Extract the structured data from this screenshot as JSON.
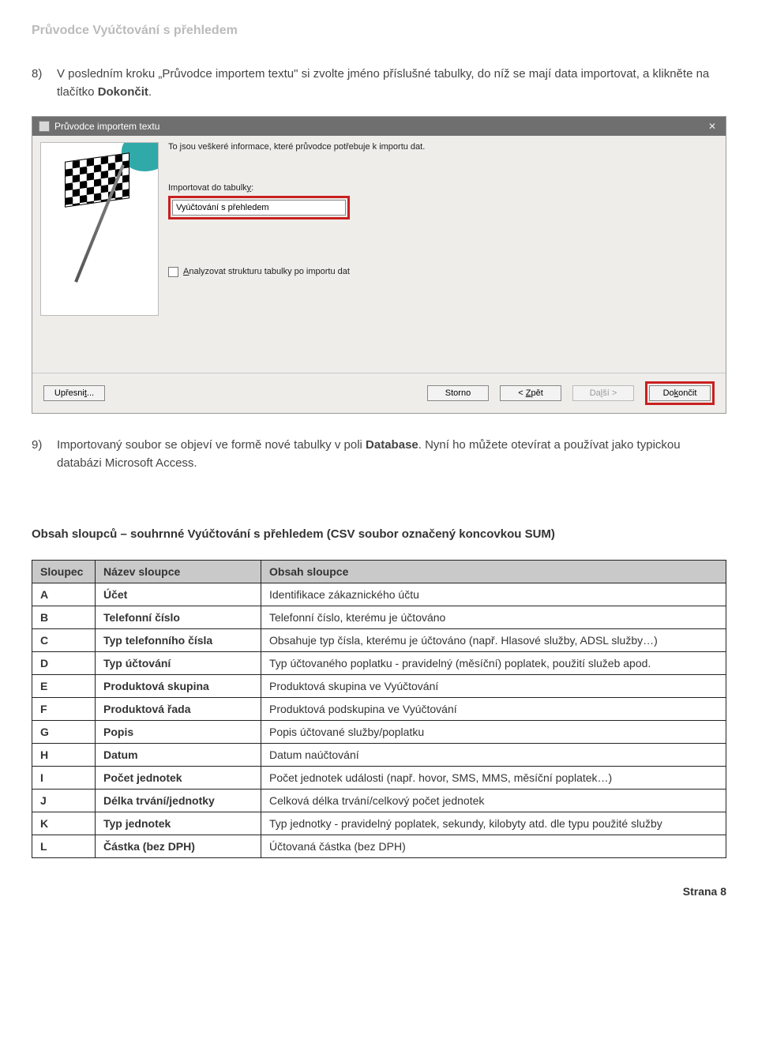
{
  "doc_title": "Průvodce Vyúčtování s přehledem",
  "step8": {
    "num": "8)",
    "text_a": "V posledním kroku „Průvodce importem textu\" si zvolte jméno příslušné tabulky, do níž se mají data importovat, a klikněte na tlačítko ",
    "text_bold": "Dokončit",
    "text_b": "."
  },
  "wizard": {
    "title": "Průvodce importem textu",
    "info": "To jsou veškeré informace, které průvodce potřebuje k importu dat.",
    "import_label": "Importovat do tabulky:",
    "import_value": "Vyúčtování s přehledem",
    "analyze_label": "Analyzovat strukturu tabulky po importu dat",
    "btn_advanced": "Upřesnit...",
    "btn_cancel": "Storno",
    "btn_back": "< Zpět",
    "btn_next": "Další >",
    "btn_finish": "Dokončit"
  },
  "step9": {
    "num": "9)",
    "text_a": "Importovaný soubor se objeví ve formě nové tabulky v poli ",
    "text_bold": "Database",
    "text_b": ". Nyní ho můžete otevírat a používat jako typickou databázi Microsoft Access."
  },
  "section_heading": "Obsah sloupců – souhrnné Vyúčtování s přehledem (CSV soubor označený koncovkou SUM)",
  "table": {
    "headers": {
      "c0": "Sloupec",
      "c1": "Název sloupce",
      "c2": "Obsah sloupce"
    },
    "rows": [
      {
        "a": "A",
        "b": "Účet",
        "c": "Identifikace zákaznického účtu"
      },
      {
        "a": "B",
        "b": "Telefonní číslo",
        "c": "Telefonní číslo, kterému je účtováno"
      },
      {
        "a": "C",
        "b": "Typ telefonního čísla",
        "c": "Obsahuje typ čísla, kterému je účtováno (např. Hlasové služby, ADSL služby…)"
      },
      {
        "a": "D",
        "b": "Typ účtování",
        "c": "Typ účtovaného poplatku - pravidelný (měsíční) poplatek, použití služeb apod."
      },
      {
        "a": "E",
        "b": "Produktová skupina",
        "c": "Produktová skupina ve Vyúčtování"
      },
      {
        "a": "F",
        "b": "Produktová řada",
        "c": "Produktová podskupina ve Vyúčtování"
      },
      {
        "a": "G",
        "b": "Popis",
        "c": "Popis účtované služby/poplatku"
      },
      {
        "a": "H",
        "b": "Datum",
        "c": "Datum naúčtování"
      },
      {
        "a": "I",
        "b": "Počet jednotek",
        "c": "Počet jednotek události (např. hovor, SMS, MMS, měsíční poplatek…)"
      },
      {
        "a": "J",
        "b": "Délka trvání/jednotky",
        "c": "Celková délka trvání/celkový počet jednotek"
      },
      {
        "a": "K",
        "b": "Typ jednotek",
        "c": "Typ jednotky - pravidelný poplatek, sekundy, kilobyty atd. dle typu použité služby"
      },
      {
        "a": "L",
        "b": "Částka (bez DPH)",
        "c": "Účtovaná částka (bez DPH)"
      }
    ]
  },
  "footer": "Strana 8"
}
